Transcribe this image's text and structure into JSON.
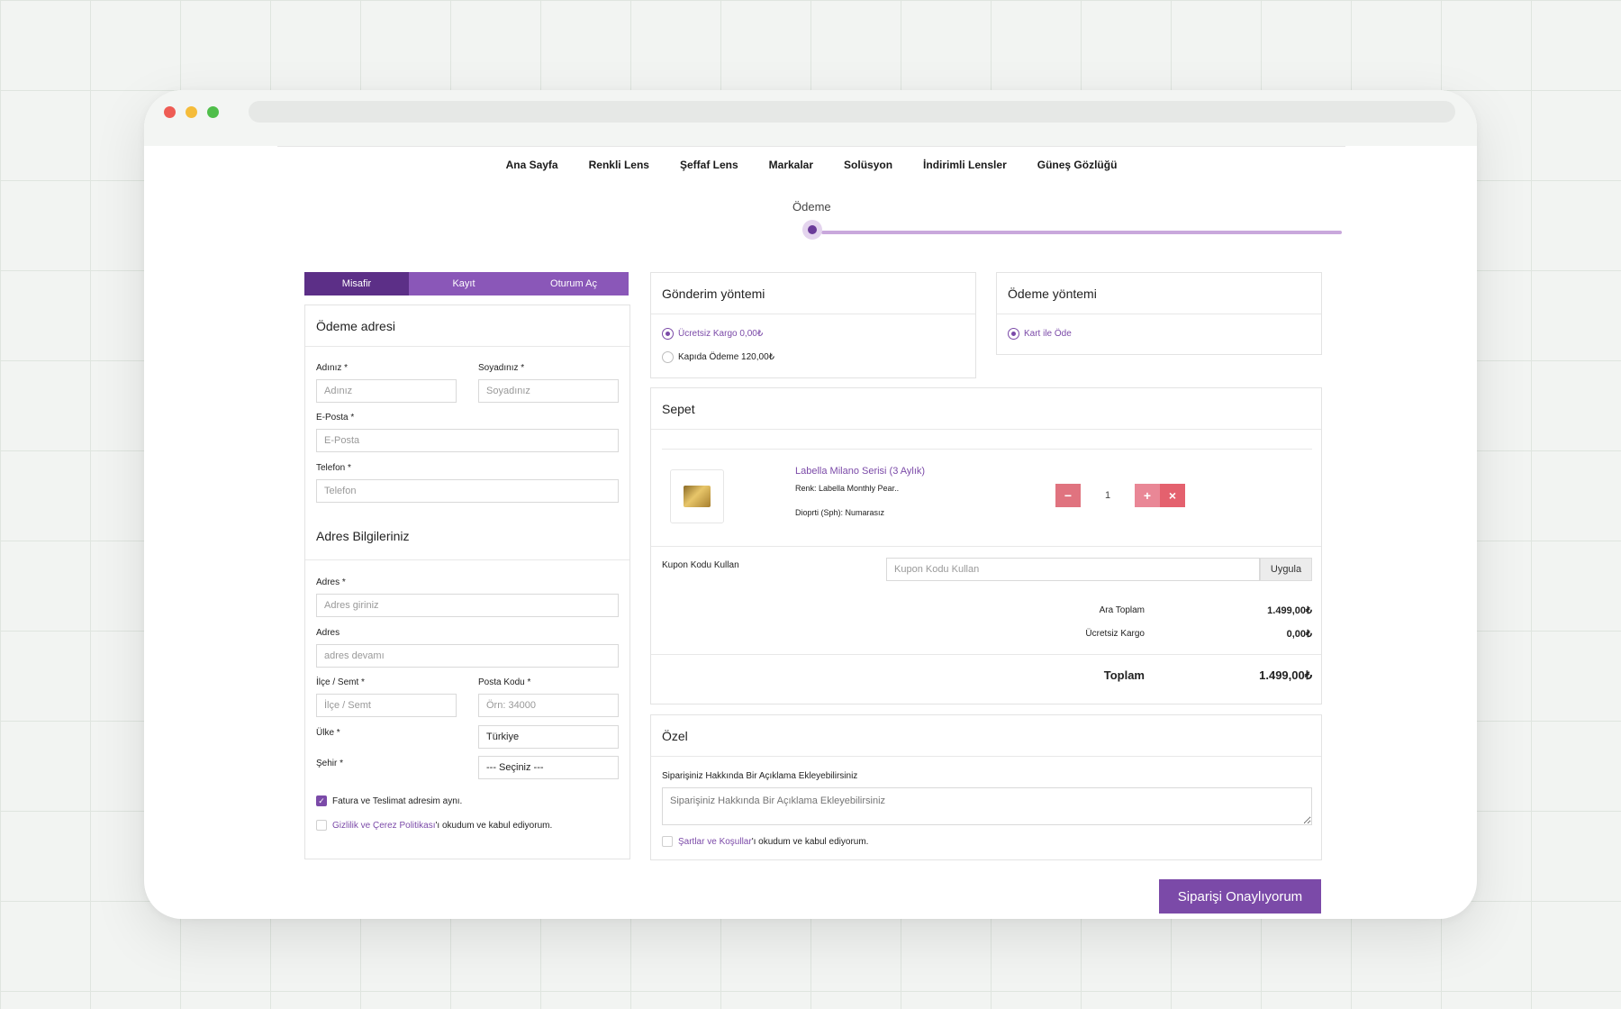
{
  "nav": [
    "Ana Sayfa",
    "Renkli Lens",
    "Şeffaf Lens",
    "Markalar",
    "Solüsyon",
    "İndirimli Lensler",
    "Güneş Gözlüğü"
  ],
  "step": {
    "label": "Ödeme",
    "progress": 0.0
  },
  "tabs": [
    "Misafir",
    "Kayıt",
    "Oturum Aç"
  ],
  "billing": {
    "title": "Ödeme adresi",
    "first_name_label": "Adınız *",
    "first_name_placeholder": "Adınız",
    "last_name_label": "Soyadınız *",
    "last_name_placeholder": "Soyadınız",
    "email_label": "E-Posta *",
    "email_placeholder": "E-Posta",
    "phone_label": "Telefon *",
    "phone_placeholder": "Telefon"
  },
  "address": {
    "title": "Adres Bilgileriniz",
    "address1_label": "Adres *",
    "address1_placeholder": "Adres giriniz",
    "address2_label": "Adres",
    "address2_placeholder": "adres devamı",
    "district_label": "İlçe / Semt *",
    "district_placeholder": "İlçe / Semt",
    "postcode_label": "Posta Kodu *",
    "postcode_placeholder": "Örn: 34000",
    "country_label": "Ülke *",
    "country_value": "Türkiye",
    "city_label": "Şehir *",
    "city_value": "--- Seçiniz ---",
    "same_address": "Fatura ve Teslimat adresim aynı.",
    "privacy_link": "Gizlilik ve Çerez Politikası",
    "privacy_rest": "'ı okudum ve kabul ediyorum."
  },
  "shipping": {
    "title": "Gönderim yöntemi",
    "options": [
      "Ücretsiz Kargo 0,00₺",
      "Kapıda Ödeme 120,00₺"
    ]
  },
  "payment": {
    "title": "Ödeme yöntemi",
    "options": [
      "Kart ile Öde"
    ]
  },
  "cart": {
    "title": "Sepet",
    "item": {
      "name": "Labella Milano Serisi (3 Aylık)",
      "color": "Renk: Labella Monthly Pear..",
      "diopter": "Dioprti (Sph): Numarasız",
      "qty": "1",
      "minus": "−",
      "plus": "+",
      "remove": "×"
    },
    "coupon_label": "Kupon Kodu Kullan",
    "coupon_placeholder": "Kupon Kodu Kullan",
    "apply": "Uygula",
    "subtotal_label": "Ara Toplam",
    "subtotal": "1.499,00₺",
    "shipping_label": "Ücretsiz Kargo",
    "shipping_value": "0,00₺",
    "total_label": "Toplam",
    "total": "1.499,00₺"
  },
  "notes": {
    "title": "Özel",
    "label": "Siparişiniz Hakkında Bir Açıklama Ekleyebilirsiniz",
    "placeholder": "Siparişiniz Hakkında Bir Açıklama Ekleyebilirsiniz",
    "terms_link": "Şartlar ve Koşullar",
    "terms_rest": "'ı okudum ve kabul ediyorum."
  },
  "submit": "Siparişi Onaylıyorum",
  "colors": {
    "accent": "#7b4aa8",
    "accent_dark": "#5c2f87",
    "minus": "#e0737f",
    "plus": "#e98796",
    "remove": "#e4616e"
  }
}
